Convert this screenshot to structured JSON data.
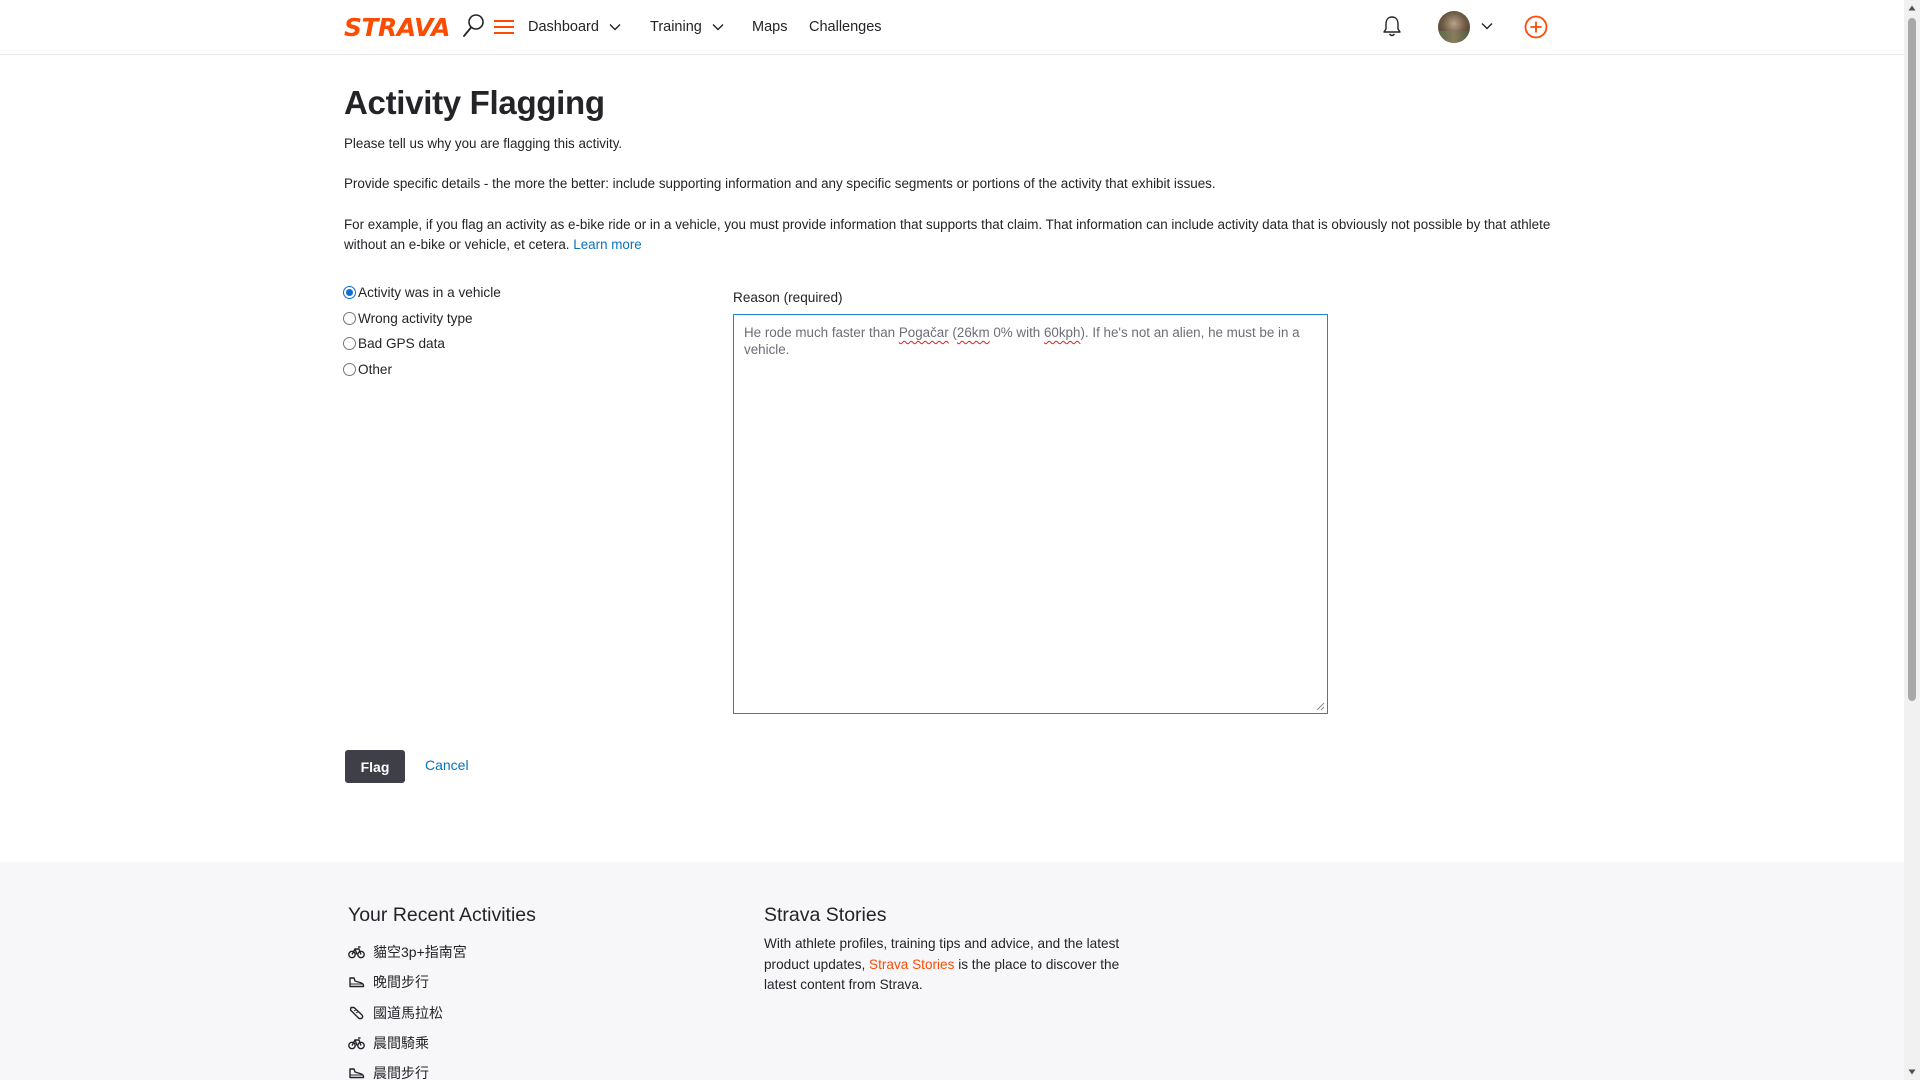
{
  "header": {
    "logo": "STRAVA",
    "nav": [
      {
        "label": "Dashboard",
        "dropdown": true
      },
      {
        "label": "Training",
        "dropdown": true
      },
      {
        "label": "Maps",
        "dropdown": false
      },
      {
        "label": "Challenges",
        "dropdown": false
      }
    ],
    "icons": [
      "search-icon",
      "menu-icon",
      "bell-icon",
      "avatar",
      "chevron-down-icon",
      "plus-circle-icon"
    ],
    "brand_color": "#fc4c02"
  },
  "page": {
    "title": "Activity Flagging",
    "intro": "Please tell us why you are flagging this activity.",
    "details": "Provide specific details - the more the better: include supporting information and any specific segments or portions of the activity that exhibit issues.",
    "example": "For example, if you flag an activity as e-bike ride or in a vehicle, you must provide information that supports that claim. That information can include activity data that is obviously not possible by that athlete without an e-bike or vehicle, et cetera.",
    "learn_more": "Learn more"
  },
  "form": {
    "options": [
      {
        "label": "Activity was in a vehicle",
        "checked": true
      },
      {
        "label": "Wrong activity type",
        "checked": false
      },
      {
        "label": "Bad GPS data",
        "checked": false
      },
      {
        "label": "Other",
        "checked": false
      }
    ],
    "reason_label": "Reason (required)",
    "reason_value": {
      "t1": "He rode much faster than ",
      "w1": "Pogačar",
      "t2": " (",
      "w2": "26km",
      "t3": " 0% with ",
      "w3": "60kph",
      "t4": "). If he's not an alien, he must be in a vehicle."
    },
    "submit": "Flag",
    "cancel": "Cancel"
  },
  "footer": {
    "recent_title": "Your Recent Activities",
    "activities": [
      {
        "icon": "bike-icon",
        "name": "貓空3p+指南宮"
      },
      {
        "icon": "shoe-icon",
        "name": "晚間步行"
      },
      {
        "icon": "run-icon",
        "name": "國道馬拉松"
      },
      {
        "icon": "bike-icon",
        "name": "晨間騎乘"
      },
      {
        "icon": "shoe-icon",
        "name": "晨間步行"
      }
    ],
    "stories_title": "Strava Stories",
    "stories_pre": "With athlete profiles, training tips and advice, and the latest product updates, ",
    "stories_link": "Strava Stories",
    "stories_post": " is the place to discover the latest content from Strava."
  }
}
